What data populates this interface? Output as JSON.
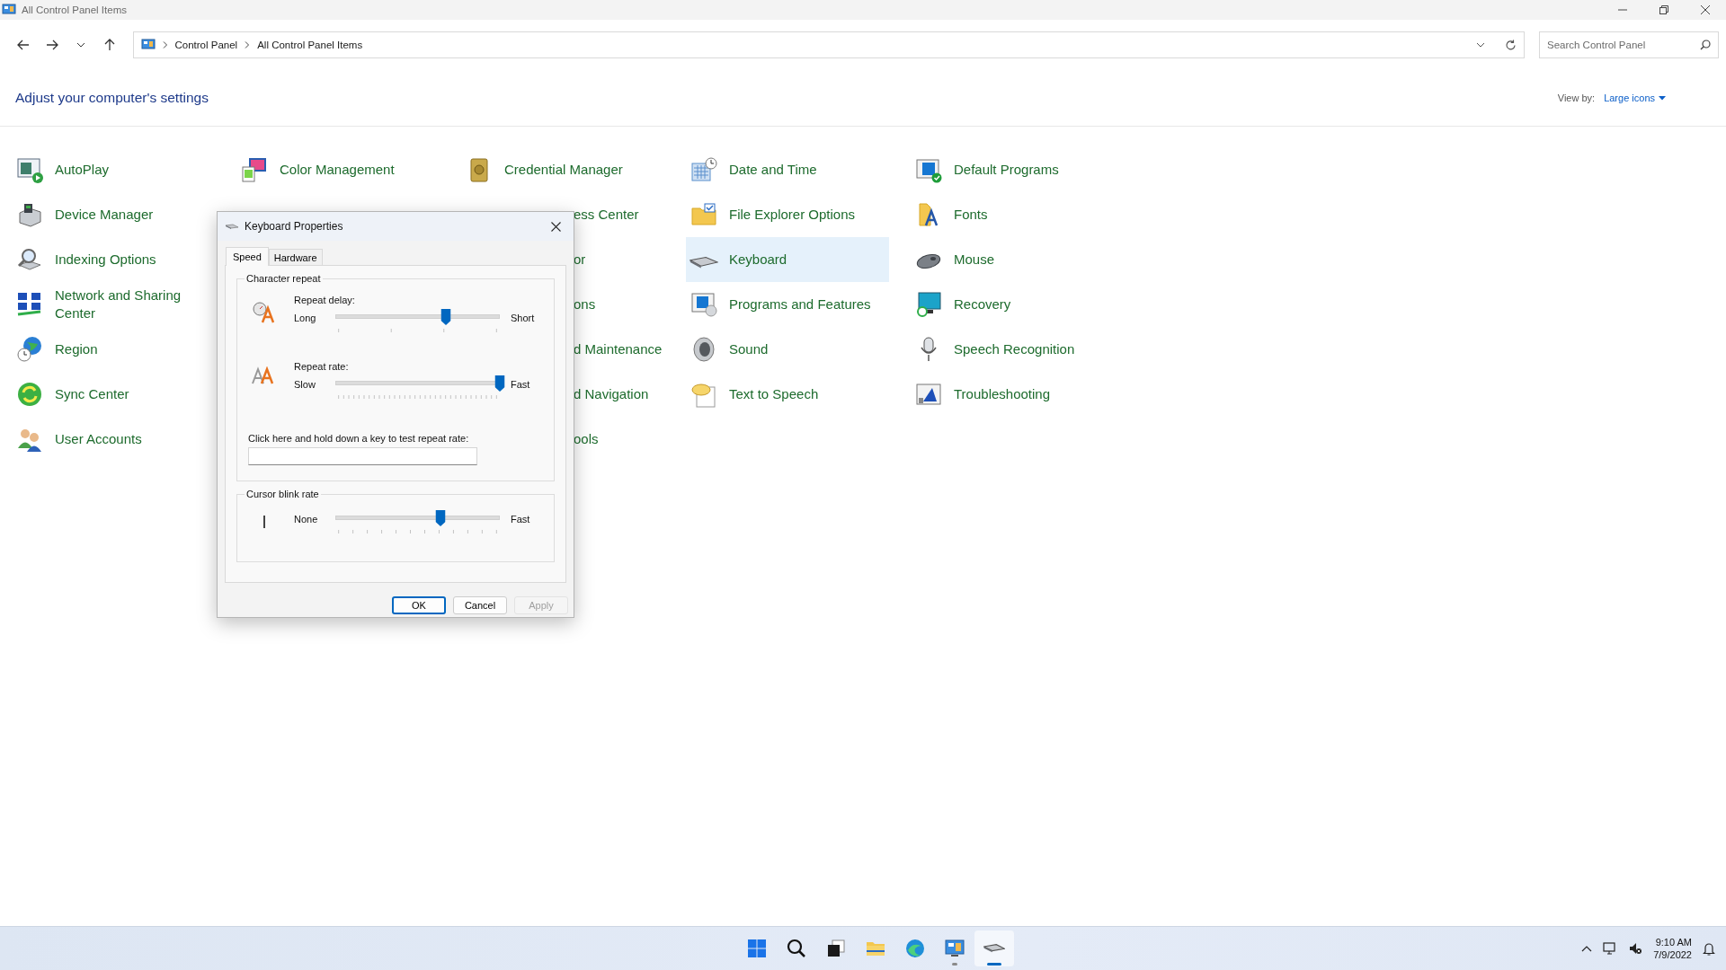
{
  "window": {
    "title": "All Control Panel Items"
  },
  "address_bar": {
    "crumbs": [
      "Control Panel",
      "All Control Panel Items"
    ]
  },
  "search": {
    "placeholder": "Search Control Panel"
  },
  "heading": "Adjust your computer's settings",
  "view_by": {
    "label": "View by:",
    "value": "Large icons"
  },
  "rows": [
    [
      {
        "kind": "item",
        "label": "AutoPlay",
        "selected": false
      },
      {
        "kind": "item",
        "label": "Color Management",
        "selected": false
      },
      {
        "kind": "item",
        "label": "Credential Manager",
        "selected": false
      },
      {
        "kind": "item",
        "label": "Date and Time",
        "selected": false
      },
      {
        "kind": "item",
        "label": "Default Programs",
        "selected": false
      }
    ],
    [
      {
        "kind": "item",
        "label": "Device Manager",
        "selected": false
      },
      {
        "kind": "partial",
        "label": "ess Center",
        "selected": false
      },
      {
        "kind": "item",
        "label": "File Explorer Options",
        "selected": false
      },
      {
        "kind": "item",
        "label": "Fonts",
        "selected": false
      }
    ],
    [
      {
        "kind": "item",
        "label": "Indexing Options",
        "selected": false
      },
      {
        "kind": "partial",
        "label": "or",
        "selected": false
      },
      {
        "kind": "item",
        "label": "Keyboard",
        "selected": true
      },
      {
        "kind": "item",
        "label": "Mouse",
        "selected": false
      }
    ],
    [
      {
        "kind": "item",
        "label": "Network and Sharing Center",
        "selected": false
      },
      {
        "kind": "partial",
        "label": "ons",
        "selected": false
      },
      {
        "kind": "item",
        "label": "Programs and Features",
        "selected": false
      },
      {
        "kind": "item",
        "label": "Recovery",
        "selected": false
      }
    ],
    [
      {
        "kind": "item",
        "label": "Region",
        "selected": false
      },
      {
        "kind": "partial",
        "label": "d Maintenance",
        "selected": false
      },
      {
        "kind": "item",
        "label": "Sound",
        "selected": false
      },
      {
        "kind": "item",
        "label": "Speech Recognition",
        "selected": false
      }
    ],
    [
      {
        "kind": "item",
        "label": "Sync Center",
        "selected": false
      },
      {
        "kind": "partial",
        "label": "d Navigation",
        "selected": false
      },
      {
        "kind": "item",
        "label": "Text to Speech",
        "selected": false
      },
      {
        "kind": "item",
        "label": "Troubleshooting",
        "selected": false
      }
    ],
    [
      {
        "kind": "item",
        "label": "User Accounts",
        "selected": false
      },
      {
        "kind": "partial",
        "label": "ools",
        "selected": false
      }
    ]
  ],
  "dialog": {
    "title": "Keyboard Properties",
    "tabs": [
      {
        "label": "Speed",
        "selected": true
      },
      {
        "label": "Hardware",
        "selected": false
      }
    ],
    "groups": [
      {
        "title": "Character repeat",
        "sliders": [
          {
            "label": "Repeat delay:",
            "min_label": "Long",
            "max_label": "Short",
            "level": 0.67
          },
          {
            "label": "Repeat rate:",
            "min_label": "Slow",
            "max_label": "Fast",
            "level": 1.0
          }
        ],
        "test_field": {
          "label": "Click here and hold down a key to test repeat rate:"
        }
      },
      {
        "title": "Cursor blink rate",
        "sliders": [
          {
            "min_label": "None",
            "max_label": "Fast",
            "level": 0.64
          }
        ]
      }
    ],
    "buttons": [
      {
        "label": "OK",
        "default": true,
        "disabled": false
      },
      {
        "label": "Cancel",
        "default": false,
        "disabled": false
      },
      {
        "label": "Apply",
        "default": false,
        "disabled": true
      }
    ]
  },
  "taskbar": {
    "apps": [
      {
        "running": false,
        "active": false
      },
      {
        "running": false,
        "active": false
      },
      {
        "running": false,
        "active": false
      },
      {
        "running": false,
        "active": false
      },
      {
        "running": false,
        "active": false
      },
      {
        "running": true,
        "active": false
      },
      {
        "running": true,
        "active": true
      }
    ],
    "time": "9:10 AM",
    "date": "7/9/2022"
  }
}
